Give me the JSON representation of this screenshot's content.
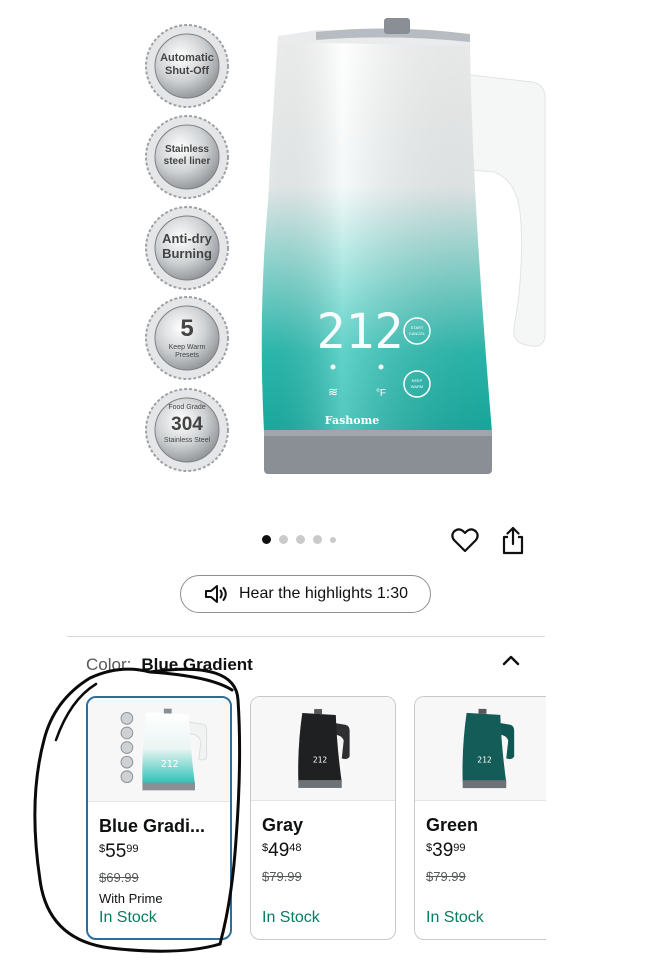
{
  "badges": [
    {
      "lines": [
        "Automatic",
        "Shut-Off"
      ]
    },
    {
      "lines": [
        "Stainless",
        "steel liner"
      ]
    },
    {
      "lines": [
        "Anti-dry",
        "Burning"
      ]
    },
    {
      "big": "5",
      "lines": [
        "Keep Warm",
        "Presets"
      ]
    },
    {
      "top": "Food Grade",
      "big": "304",
      "lines": [
        "Stainless Steel"
      ]
    }
  ],
  "kettle": {
    "display": "212",
    "unit": "°F",
    "brand": "Fashome",
    "btn_top": [
      "START",
      "CANCEL"
    ],
    "btn_bottom": [
      "KEEP",
      "WARM"
    ]
  },
  "carousel": {
    "count": 5,
    "active": 0
  },
  "hear": {
    "label": "Hear the highlights 1:30"
  },
  "color": {
    "key": "Color:",
    "value": "Blue Gradient"
  },
  "variants": [
    {
      "name": "Blue Gradi...",
      "dollars": "55",
      "cents": "99",
      "list": "$69.99",
      "prime": "With Prime",
      "stock": "In Stock",
      "selected": true
    },
    {
      "name": "Gray",
      "dollars": "49",
      "cents": "48",
      "list": "$79.99",
      "stock": "In Stock",
      "selected": false
    },
    {
      "name": "Green",
      "dollars": "39",
      "cents": "99",
      "list": "$79.99",
      "stock": "In Stock",
      "selected": false
    }
  ],
  "colors": {
    "teal": "#22c1b5",
    "grey_base": "#8a8f96",
    "stock_green": "#067d62",
    "selected_border": "#2e6c9a"
  }
}
